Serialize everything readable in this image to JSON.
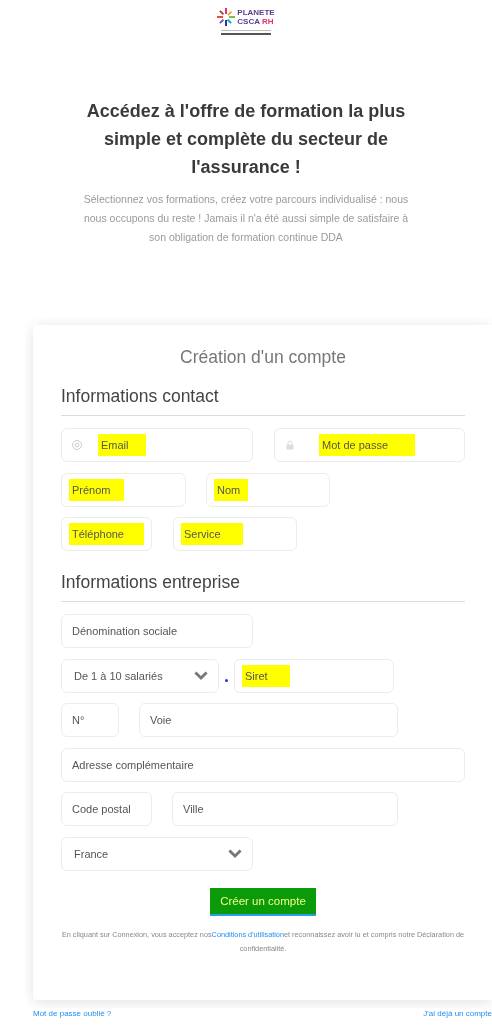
{
  "logo": {
    "line_1": "PLANETE",
    "line_2": "CSCA",
    "line_3": "RH"
  },
  "headline": "Accédez à l'offre de formation la plus simple et complète du secteur de l'assurance !",
  "intro": "Sélectionnez vos formations, créez votre parcours individualisé : nous nous occupons du reste ! Jamais il n'a été aussi simple de satisfaire à son obligation de formation continue DDA",
  "form": {
    "title": "Création d'un compte",
    "sections": [
      {
        "heading": "Informations contact",
        "fields": [
          {
            "kind": "email",
            "placeholder": "Email",
            "highlighted": true
          },
          {
            "kind": "password",
            "placeholder": "Mot de passe",
            "highlighted": true
          },
          {
            "kind": "text",
            "placeholder": "Prénom",
            "highlighted": true
          },
          {
            "kind": "text",
            "placeholder": "Nom",
            "highlighted": true
          },
          {
            "kind": "text",
            "placeholder": "Téléphone",
            "highlighted": true
          },
          {
            "kind": "text",
            "placeholder": "Service",
            "highlighted": true
          }
        ]
      },
      {
        "heading": "Informations entreprise",
        "fields": [
          {
            "kind": "text",
            "placeholder": "Dénomination sociale",
            "highlighted": false
          },
          {
            "kind": "select",
            "value": "De 1 à 10 salariés"
          },
          {
            "kind": "text",
            "placeholder": "Siret",
            "highlighted": true
          },
          {
            "kind": "text",
            "placeholder": "N°",
            "highlighted": false
          },
          {
            "kind": "text",
            "placeholder": "Voie",
            "highlighted": false
          },
          {
            "kind": "text",
            "placeholder": "Adresse complémentaire",
            "highlighted": false
          },
          {
            "kind": "text",
            "placeholder": "Code postal",
            "highlighted": false
          },
          {
            "kind": "text",
            "placeholder": "Ville",
            "highlighted": false
          },
          {
            "kind": "select",
            "value": "France"
          }
        ]
      }
    ],
    "submit": "Créer un compte",
    "disclaimer_before": "En cliquant sur Connexion, vous acceptez nos",
    "disclaimer_link": "Conditions d'utilisation",
    "disclaimer_after": "et reconnaissez avoir lu et compris notre Déclaration de confidentialité."
  },
  "footer_links": [
    "Mot de passe oublié ?",
    "J'ai déjà un compte"
  ]
}
